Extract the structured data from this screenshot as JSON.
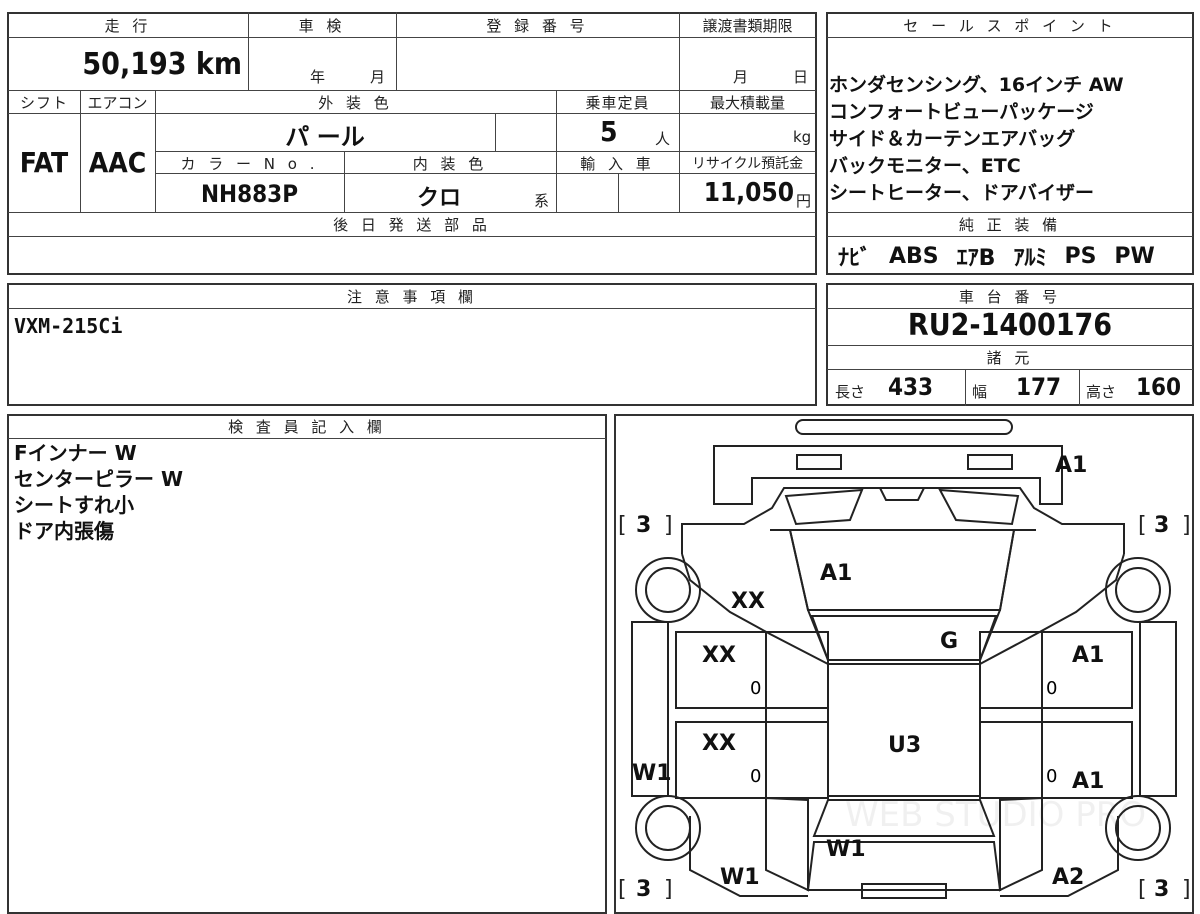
{
  "headers": {
    "mileage": "走 行",
    "shaken": "車 検",
    "registration": "登 録 番 号",
    "transfer_deadline": "譲渡書類期限",
    "sales_point": "セ ー ル ス ポ イ ン ト",
    "shift": "シフト",
    "aircon": "エアコン",
    "exterior_color": "外 装 色",
    "capacity": "乗車定員",
    "max_load": "最大積載量",
    "color_no": "カ ラ ー N o .",
    "interior_color": "内 装 色",
    "import": "輸 入 車",
    "recycle": "リサイクル預託金",
    "later_parts": "後 日 発 送 部 品",
    "genuine": "純 正 装 備",
    "notes": "注 意 事 項 欄",
    "chassis_no": "車 台 番 号",
    "specs": "諸 元",
    "inspector": "検 査 員 記 入 欄"
  },
  "values": {
    "mileage": "50,193 km",
    "shaken_year": "年",
    "shaken_month": "月",
    "deadline_month": "月",
    "deadline_day": "日",
    "shift": "FAT",
    "aircon": "AAC",
    "exterior_color": "パ ール",
    "capacity": "5",
    "capacity_unit": "人",
    "load_unit": "kg",
    "color_no": "NH883P",
    "interior_color": "クロ",
    "interior_suffix": "系",
    "recycle": "11,050",
    "recycle_unit": "円",
    "notes": "VXM-215Ci",
    "chassis_no": "RU2-1400176",
    "length_label": "長さ",
    "length": "433",
    "width_label": "幅",
    "width": "177",
    "height_label": "高さ",
    "height": "160"
  },
  "sales_points": [
    "ホンダセンシング、16インチ AW",
    "コンフォートビューパッケージ",
    "サイド＆カーテンエアバッグ",
    "バックモニター、ETC",
    "シートヒーター、ドアバイザー"
  ],
  "genuine_equipment": [
    "ﾅﾋﾞ",
    "ABS",
    "ｴｱB",
    "ｱﾙﾐ",
    "PS",
    "PW"
  ],
  "inspector_notes": [
    "Fインナー W",
    "センターピラー W",
    "シートすれ小",
    "ドア内張傷"
  ],
  "diagram": {
    "bumper_front": "A1",
    "hood": "A1",
    "front_left_fender": "XX",
    "front_left_door": "XX",
    "roof": "G",
    "front_right_door": "A1",
    "rear_left_door": "XX",
    "center": "U3",
    "rear_right_door": "A1",
    "left_rocker": "W1",
    "trunk": "W1",
    "rear_left_quarter": "W1",
    "rear_right_quarter": "A2",
    "tire_fl": "3",
    "tire_fr": "3",
    "tire_rl": "3",
    "tire_rr": "3",
    "zero": "0",
    "watermark": "WEB STUDIO PRO"
  }
}
